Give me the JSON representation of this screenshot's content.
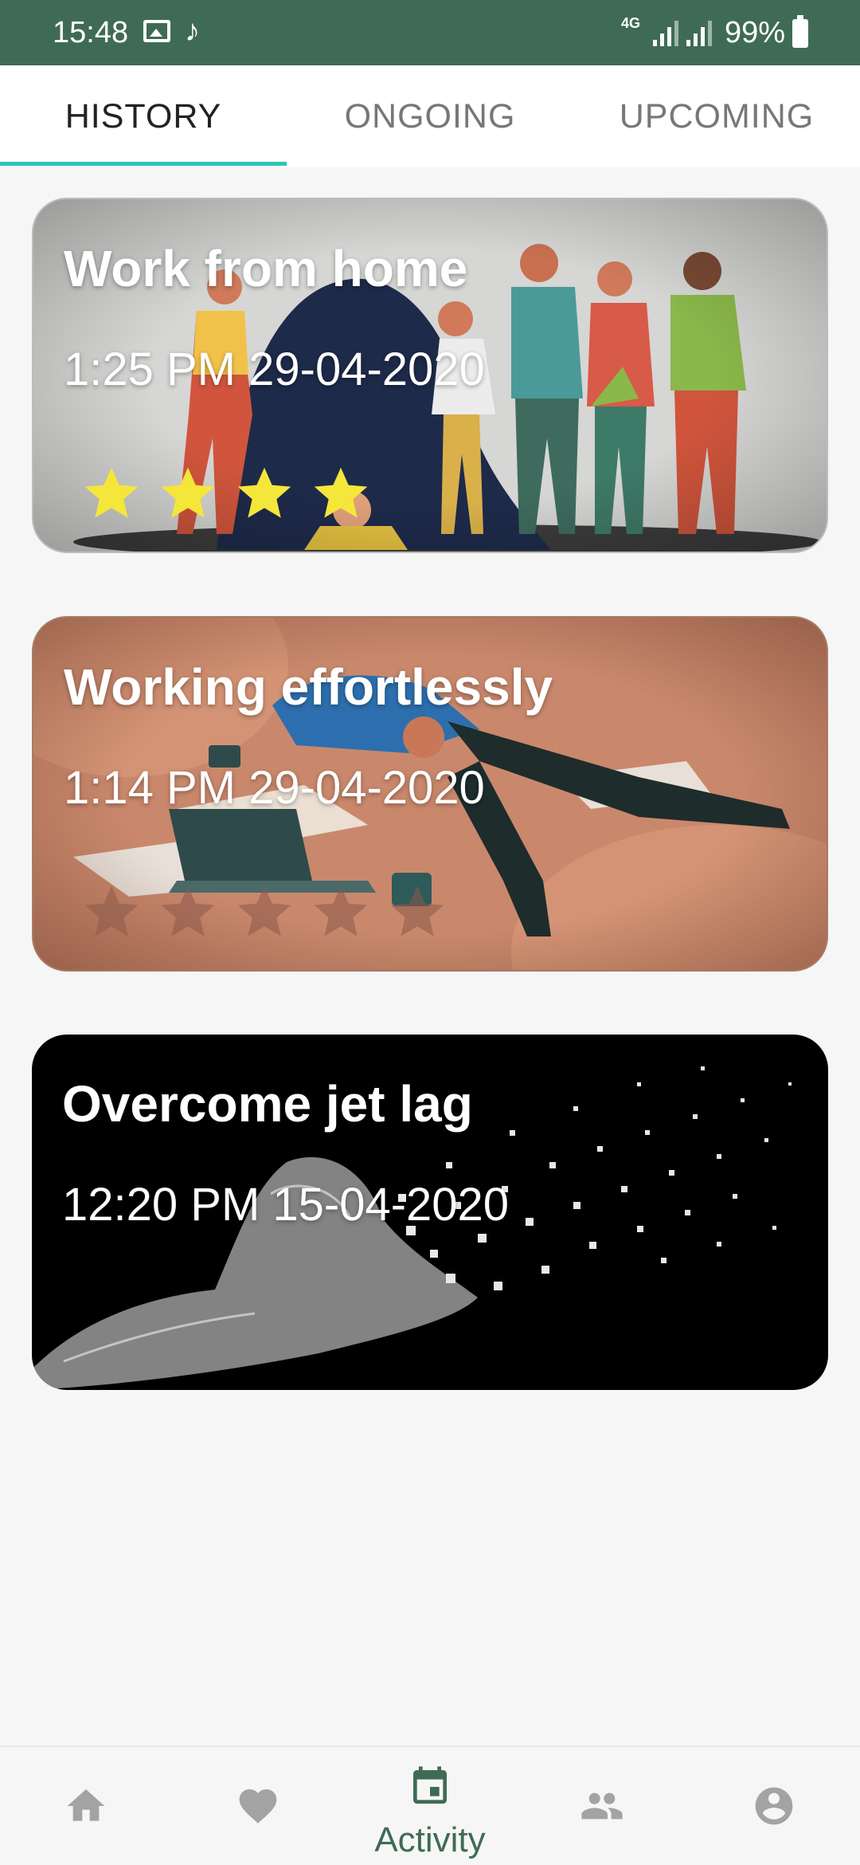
{
  "status_bar": {
    "time": "15:48",
    "network": "4G",
    "battery": "99%",
    "icons": [
      "gallery-icon",
      "music-note-icon",
      "signal-icon",
      "signal-icon",
      "battery-icon"
    ]
  },
  "tabs": [
    {
      "label": "HISTORY",
      "active": true
    },
    {
      "label": "ONGOING",
      "active": false
    },
    {
      "label": "UPCOMING",
      "active": false
    }
  ],
  "cards": [
    {
      "title": "Work from home",
      "time": "1:25 PM 29-04-2020",
      "rating": 4
    },
    {
      "title": "Working effortlessly",
      "time": "1:14 PM 29-04-2020",
      "rating": 0
    },
    {
      "title": "Overcome jet lag",
      "time": "12:20 PM 15-04-2020",
      "rating": null
    }
  ],
  "bottom_nav": {
    "items": [
      {
        "icon": "home-icon"
      },
      {
        "icon": "heart-icon"
      },
      {
        "icon": "calendar-icon",
        "label": "Activity",
        "active": true
      },
      {
        "icon": "people-icon"
      },
      {
        "icon": "account-icon"
      }
    ]
  },
  "colors": {
    "status_bar": "#3f6b54",
    "tab_indicator": "#2ec4b6",
    "nav_active": "#3f6b54",
    "nav_inactive": "#a3a3a3",
    "star_filled": "#f5e63a",
    "star_empty": "#8a5a4a"
  }
}
